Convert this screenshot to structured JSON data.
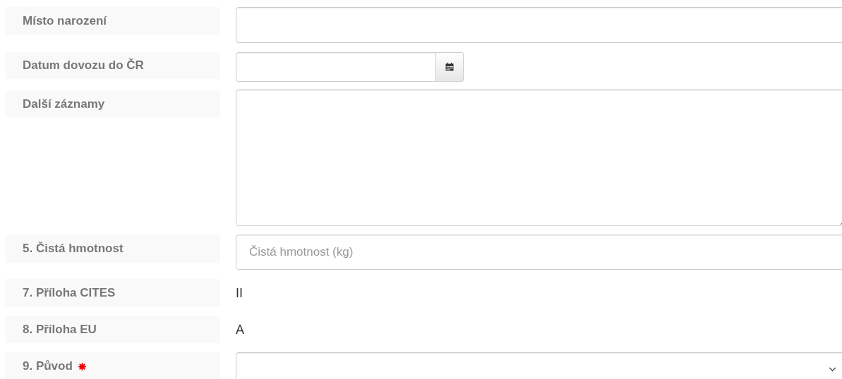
{
  "fields": [
    {
      "kind": "text",
      "label": "Místo narození",
      "required": false
    },
    {
      "kind": "date",
      "label": "Datum dovozu do ČR",
      "required": false
    },
    {
      "kind": "textarea",
      "label": "Další záznamy",
      "required": false
    },
    {
      "kind": "text",
      "label": "5. Čistá hmotnost",
      "required": false,
      "placeholder": "Čistá hmotnost (kg)"
    },
    {
      "kind": "static",
      "label": "7. Příloha CITES",
      "required": false,
      "value": "II"
    },
    {
      "kind": "static",
      "label": "8. Příloha EU",
      "required": false,
      "value": "A"
    },
    {
      "kind": "select",
      "label": "9. Původ",
      "required": true
    }
  ]
}
